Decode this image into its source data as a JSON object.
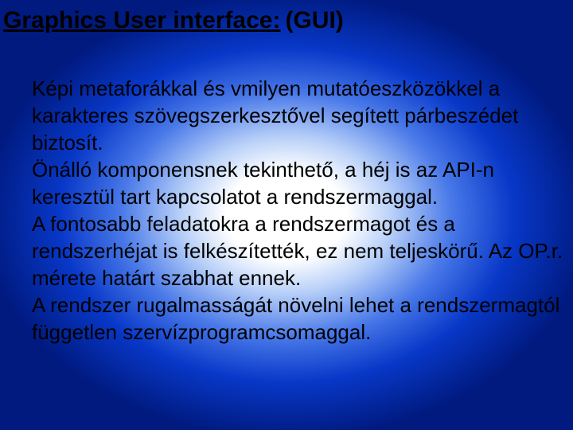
{
  "title": {
    "underlined": "Graphics User interface:",
    "plain": "(GUI)"
  },
  "body": "Képi metaforákkal és vmilyen mutatóeszközökkel a karakteres szövegszerkesztővel segített párbeszédet biztosít.\nÖnálló komponensnek tekinthető, a héj is az API-n keresztül tart kapcsolatot a rendszermaggal.\nA fontosabb feladatokra a rendszermagot és a rendszerhéjat is felkészítették, ez nem teljeskörű. Az OP.r. mérete határt szabhat ennek.\nA rendszer rugalmasságát növelni lehet a rendszermagtól független szervízprogramcsomaggal."
}
